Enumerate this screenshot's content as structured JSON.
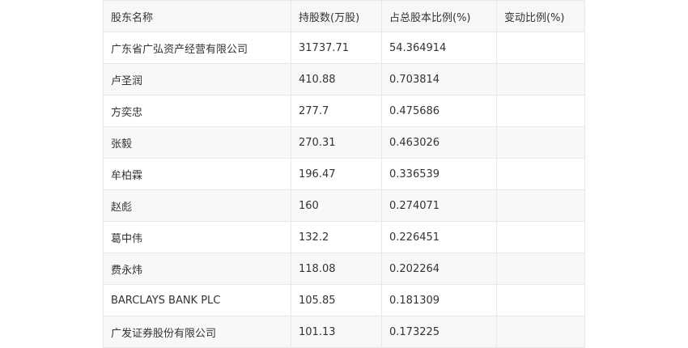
{
  "table": {
    "headers": [
      "股东名称",
      "持股数(万股)",
      "占总股本比例(%)",
      "变动比例(%)"
    ],
    "rows": [
      [
        "广东省广弘资产经营有限公司",
        "31737.71",
        "54.364914",
        ""
      ],
      [
        "卢圣润",
        "410.88",
        "0.703814",
        ""
      ],
      [
        "方奕忠",
        "277.7",
        "0.475686",
        ""
      ],
      [
        "张毅",
        "270.31",
        "0.463026",
        ""
      ],
      [
        "牟柏霖",
        "196.47",
        "0.336539",
        ""
      ],
      [
        "赵彪",
        "160",
        "0.274071",
        ""
      ],
      [
        "葛中伟",
        "132.2",
        "0.226451",
        ""
      ],
      [
        "费永炜",
        "118.08",
        "0.202264",
        ""
      ],
      [
        "BARCLAYS BANK PLC",
        "105.85",
        "0.181309",
        ""
      ],
      [
        "广发证券股份有限公司",
        "101.13",
        "0.173225",
        ""
      ]
    ]
  }
}
